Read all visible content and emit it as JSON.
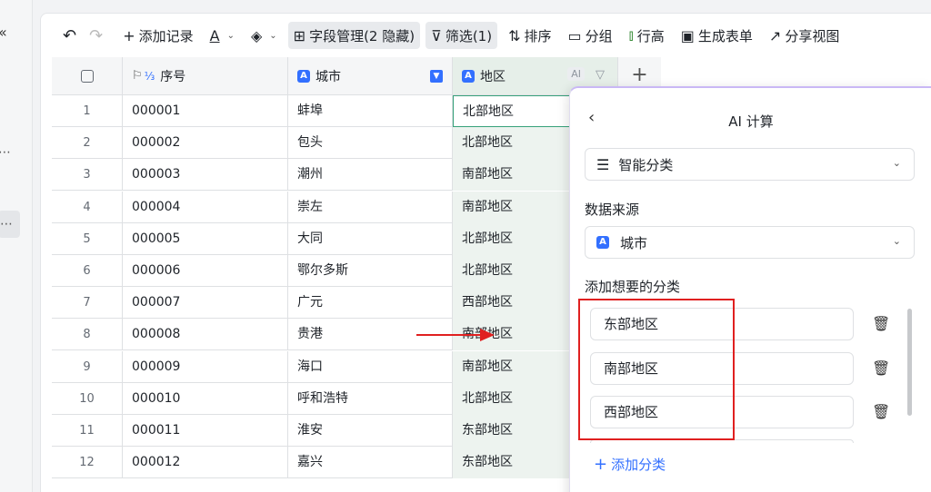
{
  "left_strip": {
    "collapse_icon": "chevron-double-left-icon",
    "dots": "⋯"
  },
  "toolbar": {
    "add_record": "添加记录",
    "field_manage": "字段管理(2 隐藏)",
    "filter": "筛选(1)",
    "sort": "排序",
    "group": "分组",
    "row_height": "行高",
    "gen_form": "生成表单",
    "share_view": "分享视图"
  },
  "table": {
    "headers": {
      "seq": "序号",
      "city": "城市",
      "region": "地区",
      "ai_tag": "AI"
    },
    "rows": [
      {
        "idx": "1",
        "seq": "000001",
        "city": "蚌埠",
        "region": "北部地区"
      },
      {
        "idx": "2",
        "seq": "000002",
        "city": "包头",
        "region": "北部地区"
      },
      {
        "idx": "3",
        "seq": "000003",
        "city": "潮州",
        "region": "南部地区"
      },
      {
        "idx": "4",
        "seq": "000004",
        "city": "崇左",
        "region": "南部地区"
      },
      {
        "idx": "5",
        "seq": "000005",
        "city": "大同",
        "region": "北部地区"
      },
      {
        "idx": "6",
        "seq": "000006",
        "city": "鄂尔多斯",
        "region": "北部地区"
      },
      {
        "idx": "7",
        "seq": "000007",
        "city": "广元",
        "region": "西部地区"
      },
      {
        "idx": "8",
        "seq": "000008",
        "city": "贵港",
        "region": "南部地区"
      },
      {
        "idx": "9",
        "seq": "000009",
        "city": "海口",
        "region": "南部地区"
      },
      {
        "idx": "10",
        "seq": "000010",
        "city": "呼和浩特",
        "region": "北部地区"
      },
      {
        "idx": "11",
        "seq": "000011",
        "city": "淮安",
        "region": "东部地区"
      },
      {
        "idx": "12",
        "seq": "000012",
        "city": "嘉兴",
        "region": "东部地区"
      }
    ]
  },
  "ai_panel": {
    "title": "AI 计算",
    "mode": "智能分类",
    "source_label": "数据来源",
    "source_value": "城市",
    "categories_label": "添加想要的分类",
    "categories": [
      "东部地区",
      "南部地区",
      "西部地区"
    ],
    "add_category": "添加分类"
  },
  "colors": {
    "accent": "#3370ff",
    "highlight": "#e02020",
    "selected_col": "#edf3ef"
  }
}
